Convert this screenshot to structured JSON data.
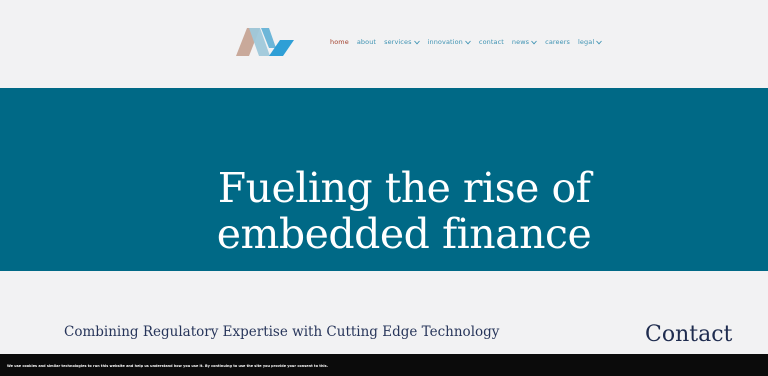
{
  "header": {
    "logo": "brand-logo-icon",
    "nav": [
      {
        "label": "home",
        "active": true,
        "dropdown": false
      },
      {
        "label": "about",
        "active": false,
        "dropdown": false
      },
      {
        "label": "services",
        "active": false,
        "dropdown": true
      },
      {
        "label": "innovation",
        "active": false,
        "dropdown": true
      },
      {
        "label": "contact",
        "active": false,
        "dropdown": false
      },
      {
        "label": "news",
        "active": false,
        "dropdown": true
      },
      {
        "label": "careers",
        "active": false,
        "dropdown": false
      },
      {
        "label": "legal",
        "active": false,
        "dropdown": true
      }
    ]
  },
  "hero": {
    "line1": "Fueling the rise of",
    "line2": "embedded finance"
  },
  "content": {
    "tagline": "Combining Regulatory Expertise with Cutting Edge Technology",
    "contact_heading": "Contact"
  },
  "cookie": {
    "text": "We use cookies and similar technologies to run this website and help us understand how you use it. By continuing to use the site you provide your consent to this."
  },
  "colors": {
    "hero_bg": "#006986",
    "nav_link": "#3f93b3",
    "nav_active": "#a3432f",
    "page_bg": "#f2f2f3",
    "cookie_bg": "#0b0b0b"
  }
}
